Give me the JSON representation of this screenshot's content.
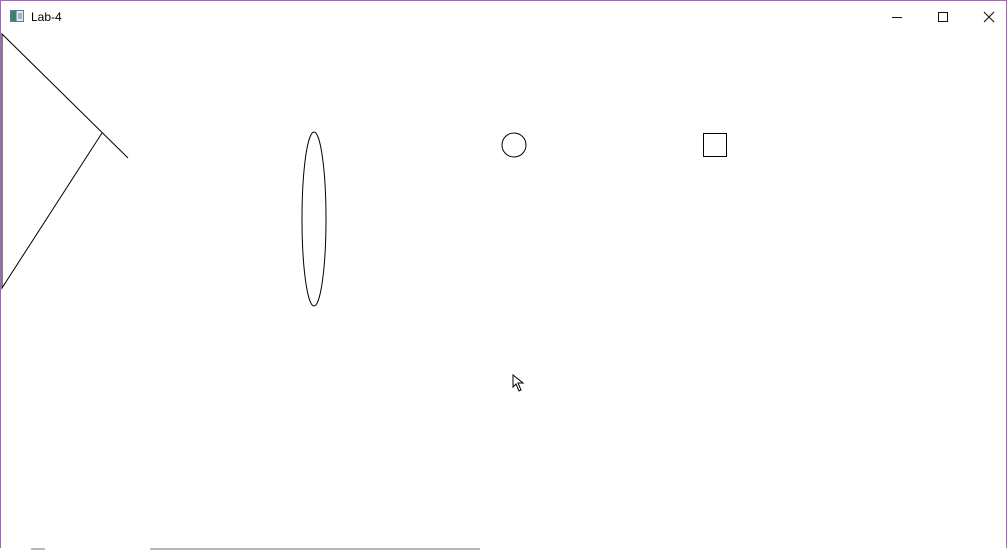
{
  "window": {
    "title": "Lab-4",
    "border_color": "#b45bc9",
    "background": "#ffffff"
  },
  "titlebar": {
    "icon": "app-window-icon",
    "controls": [
      {
        "name": "minimize",
        "icon": "minimize-icon"
      },
      {
        "name": "maximize",
        "icon": "maximize-icon"
      },
      {
        "name": "close",
        "icon": "close-icon"
      }
    ]
  },
  "canvas": {
    "shapes": [
      {
        "name": "triangle-line-shape",
        "type": "polyline"
      },
      {
        "name": "ellipse-shape",
        "type": "ellipse"
      },
      {
        "name": "circle-shape",
        "type": "circle"
      },
      {
        "name": "square-shape",
        "type": "rectangle"
      },
      {
        "name": "cursor-icon",
        "type": "pointer"
      }
    ],
    "stroke_color": "#000000"
  }
}
